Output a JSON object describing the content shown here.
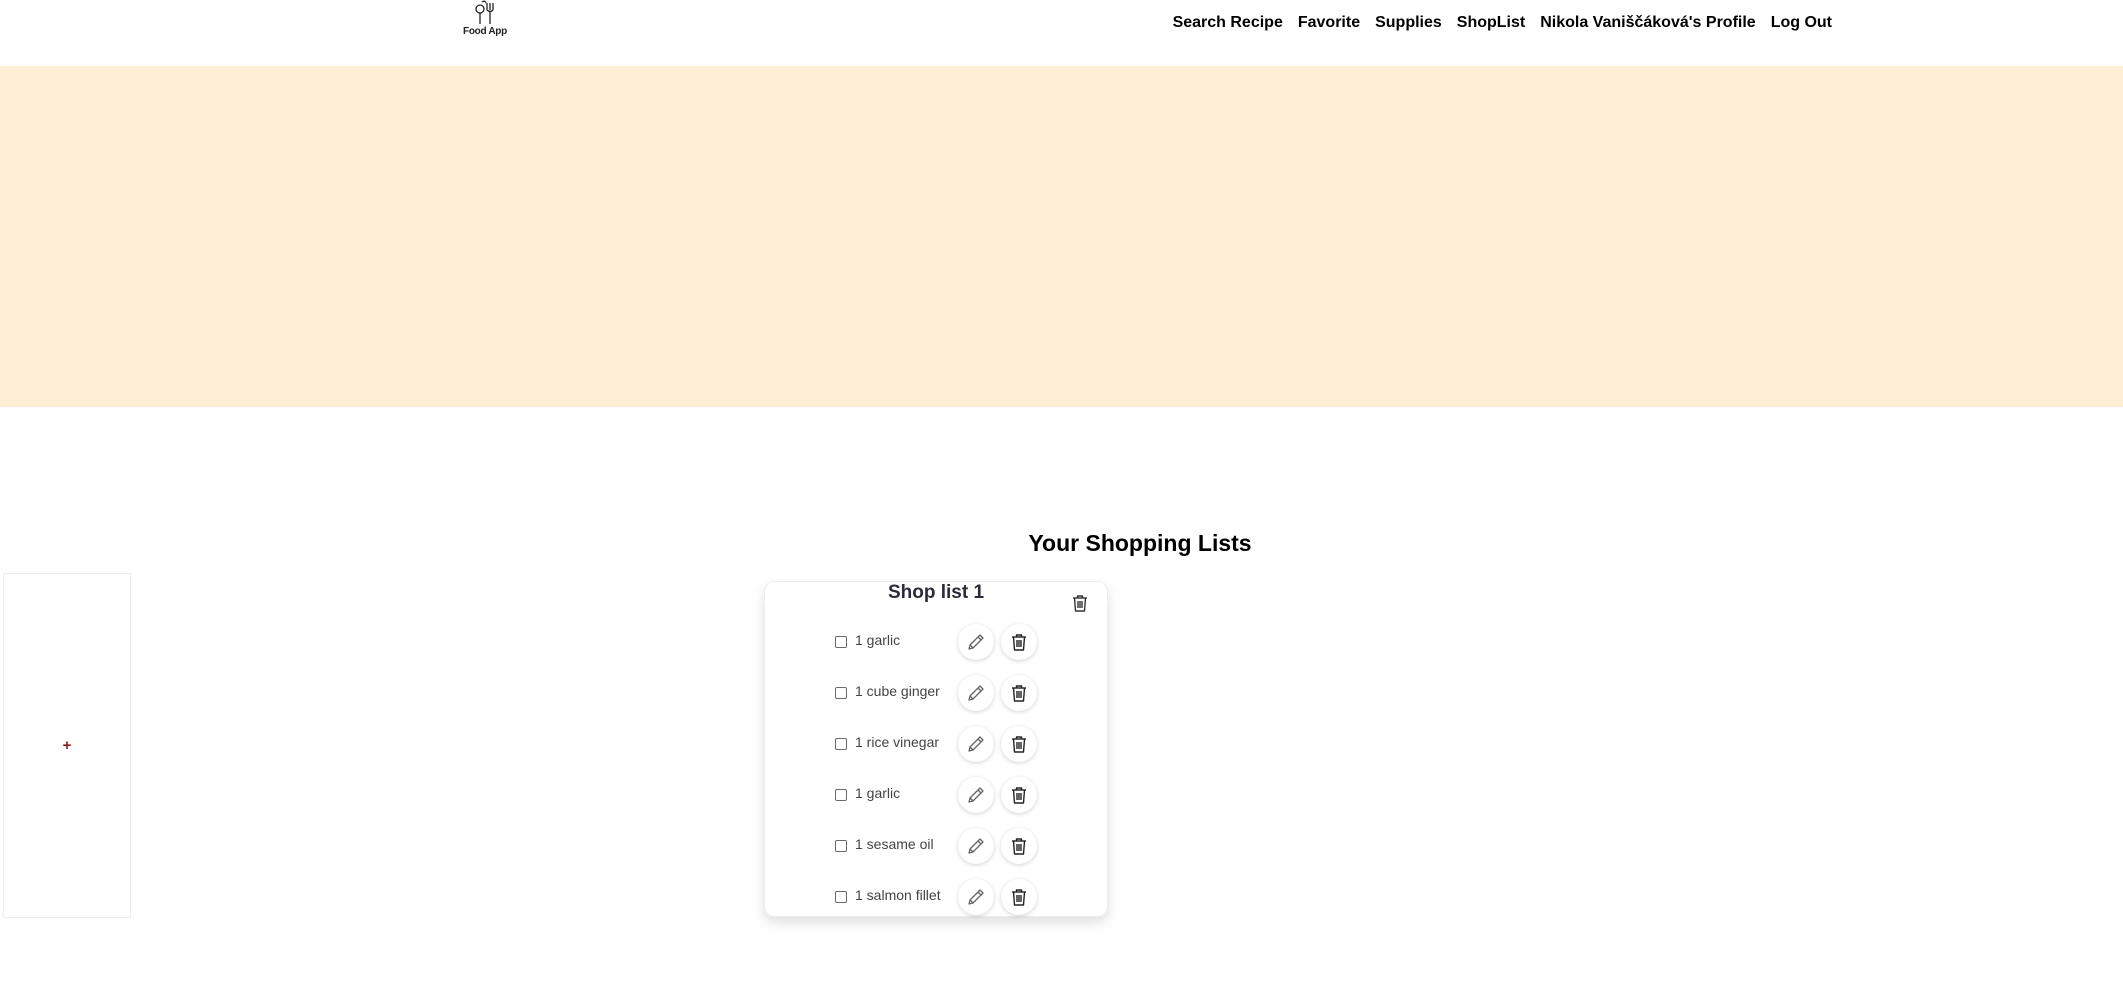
{
  "header": {
    "logo_text": "Food App",
    "nav": [
      {
        "label": "Search Recipe",
        "name": "nav-search-recipe"
      },
      {
        "label": "Favorite",
        "name": "nav-favorite"
      },
      {
        "label": "Supplies",
        "name": "nav-supplies"
      },
      {
        "label": "ShopList",
        "name": "nav-shoplist"
      },
      {
        "label": "Nikola Vaniščáková's Profile",
        "name": "nav-profile"
      },
      {
        "label": "Log Out",
        "name": "nav-log-out"
      }
    ]
  },
  "colors": {
    "hero_background": "#fdeed5",
    "add_symbol": "#8b1a1a"
  },
  "main": {
    "title": "Your Shopping Lists",
    "add_label": "+",
    "lists": [
      {
        "title": "Shop list 1",
        "items": [
          {
            "label": "1 garlic",
            "checked": false
          },
          {
            "label": "1 cube ginger",
            "checked": false
          },
          {
            "label": "1 rice vinegar",
            "checked": false
          },
          {
            "label": "1 garlic",
            "checked": false
          },
          {
            "label": "1 sesame oil",
            "checked": false
          },
          {
            "label": "1 salmon fillet",
            "checked": false
          }
        ]
      }
    ]
  },
  "icons": {
    "logo": "chef-hat-utensils-icon",
    "edit": "pencil-icon",
    "delete": "trash-icon"
  }
}
